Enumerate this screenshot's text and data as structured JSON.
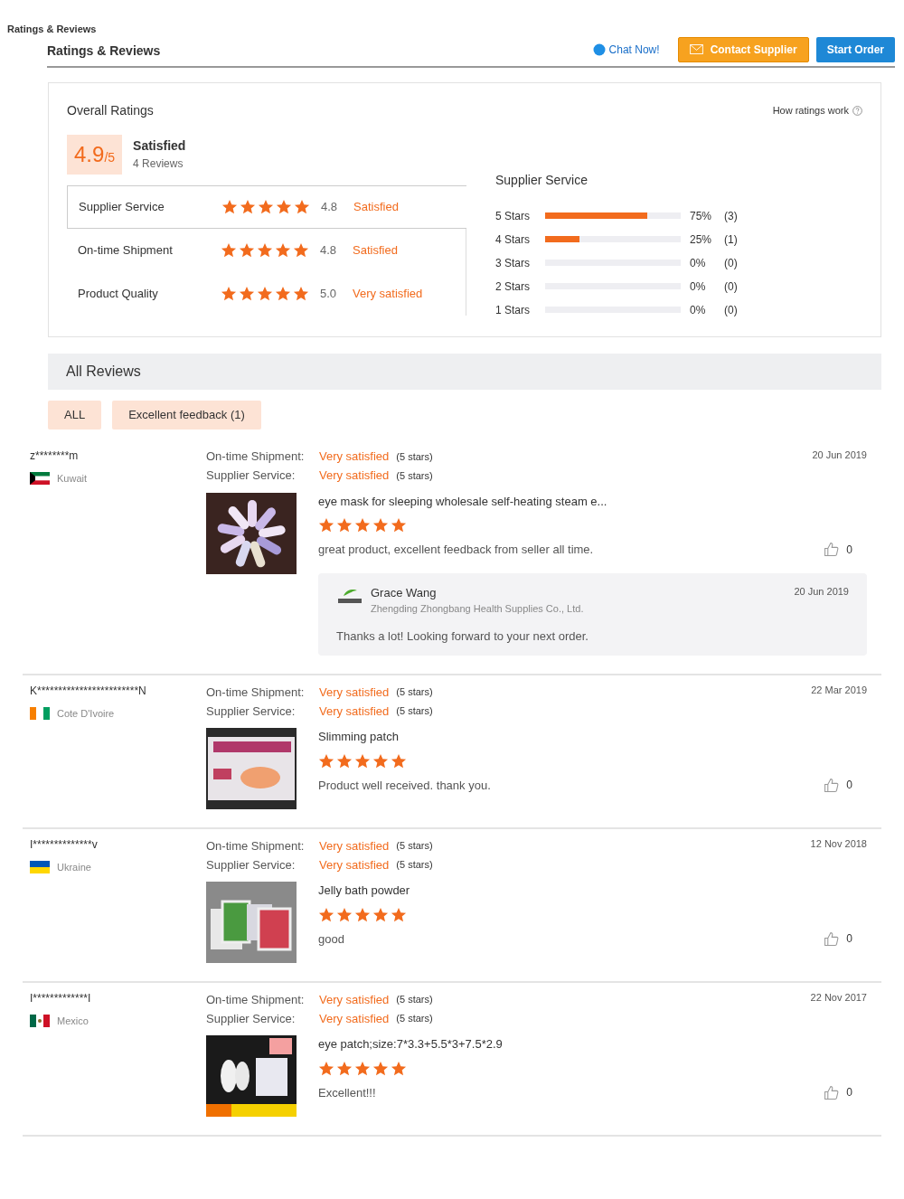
{
  "breadcrumb": "Ratings & Reviews",
  "header": {
    "title": "Ratings & Reviews",
    "chat": "Chat Now!",
    "contact": "Contact Supplier",
    "start": "Start Order"
  },
  "overall": {
    "title": "Overall Ratings",
    "how": "How ratings work",
    "score": "4.9",
    "score_max": "/5",
    "summary": "Satisfied",
    "count": "4 Reviews",
    "categories": [
      {
        "name": "Supplier Service",
        "stars": 5,
        "score": "4.8",
        "verdict": "Satisfied",
        "selected": true
      },
      {
        "name": "On-time Shipment",
        "stars": 5,
        "score": "4.8",
        "verdict": "Satisfied",
        "selected": false
      },
      {
        "name": "Product Quality",
        "stars": 5,
        "score": "5.0",
        "verdict": "Very satisfied",
        "selected": false
      }
    ],
    "histogram_title": "Supplier Service",
    "histogram": [
      {
        "label": "5 Stars",
        "level": 0.75,
        "percent": "75%",
        "count": "(3)"
      },
      {
        "label": "4 Stars",
        "level": 0.25,
        "percent": "25%",
        "count": "(1)"
      },
      {
        "label": "3 Stars",
        "level": 0,
        "percent": "0%",
        "count": "(0)"
      },
      {
        "label": "2 Stars",
        "level": 0,
        "percent": "0%",
        "count": "(0)"
      },
      {
        "label": "1 Stars",
        "level": 0,
        "percent": "0%",
        "count": "(0)"
      }
    ]
  },
  "all_reviews": {
    "title": "All Reviews",
    "filters": [
      "ALL",
      "Excellent feedback (1)"
    ]
  },
  "reviews": [
    {
      "user": "z********m",
      "country": "Kuwait",
      "flag": {
        "kind": "kuwait"
      },
      "date": "20 Jun 2019",
      "ratings": [
        {
          "label": "On-time Shipment:",
          "verdict": "Very satisfied",
          "note": "(5 stars)"
        },
        {
          "label": "Supplier Service:",
          "verdict": "Very satisfied",
          "note": "(5 stars)"
        }
      ],
      "product": "eye mask for sleeping wholesale self-heating steam e...",
      "stars": 5,
      "comment": "great product, excellent feedback from seller all time.",
      "likes": "0",
      "reply": {
        "name": "Grace Wang",
        "company": "Zhengding Zhongbang Health Supplies Co., Ltd.",
        "date": "20 Jun 2019",
        "text": "Thanks a lot! Looking forward to your next order."
      }
    },
    {
      "user": "K************************N",
      "country": "Cote D'Ivoire",
      "flag": {
        "kind": "ivory"
      },
      "date": "22 Mar 2019",
      "ratings": [
        {
          "label": "On-time Shipment:",
          "verdict": "Very satisfied",
          "note": "(5 stars)"
        },
        {
          "label": "Supplier Service:",
          "verdict": "Very satisfied",
          "note": "(5 stars)"
        }
      ],
      "product": "Slimming patch",
      "stars": 5,
      "comment": "Product well received. thank you.",
      "likes": "0"
    },
    {
      "user": "I**************v",
      "country": "Ukraine",
      "flag": {
        "kind": "ukraine"
      },
      "date": "12 Nov 2018",
      "ratings": [
        {
          "label": "On-time Shipment:",
          "verdict": "Very satisfied",
          "note": "(5 stars)"
        },
        {
          "label": "Supplier Service:",
          "verdict": "Very satisfied",
          "note": "(5 stars)"
        }
      ],
      "product": "Jelly bath powder",
      "stars": 5,
      "comment": "good",
      "likes": "0"
    },
    {
      "user": "I*************I",
      "country": "Mexico",
      "flag": {
        "kind": "mexico"
      },
      "date": "22 Nov 2017",
      "ratings": [
        {
          "label": "On-time Shipment:",
          "verdict": "Very satisfied",
          "note": "(5 stars)"
        },
        {
          "label": "Supplier Service:",
          "verdict": "Very satisfied",
          "note": "(5 stars)"
        }
      ],
      "product": "eye patch;size:7*3.3+5.5*3+7.5*2.9",
      "stars": 5,
      "comment": "Excellent!!!",
      "likes": "0"
    }
  ]
}
